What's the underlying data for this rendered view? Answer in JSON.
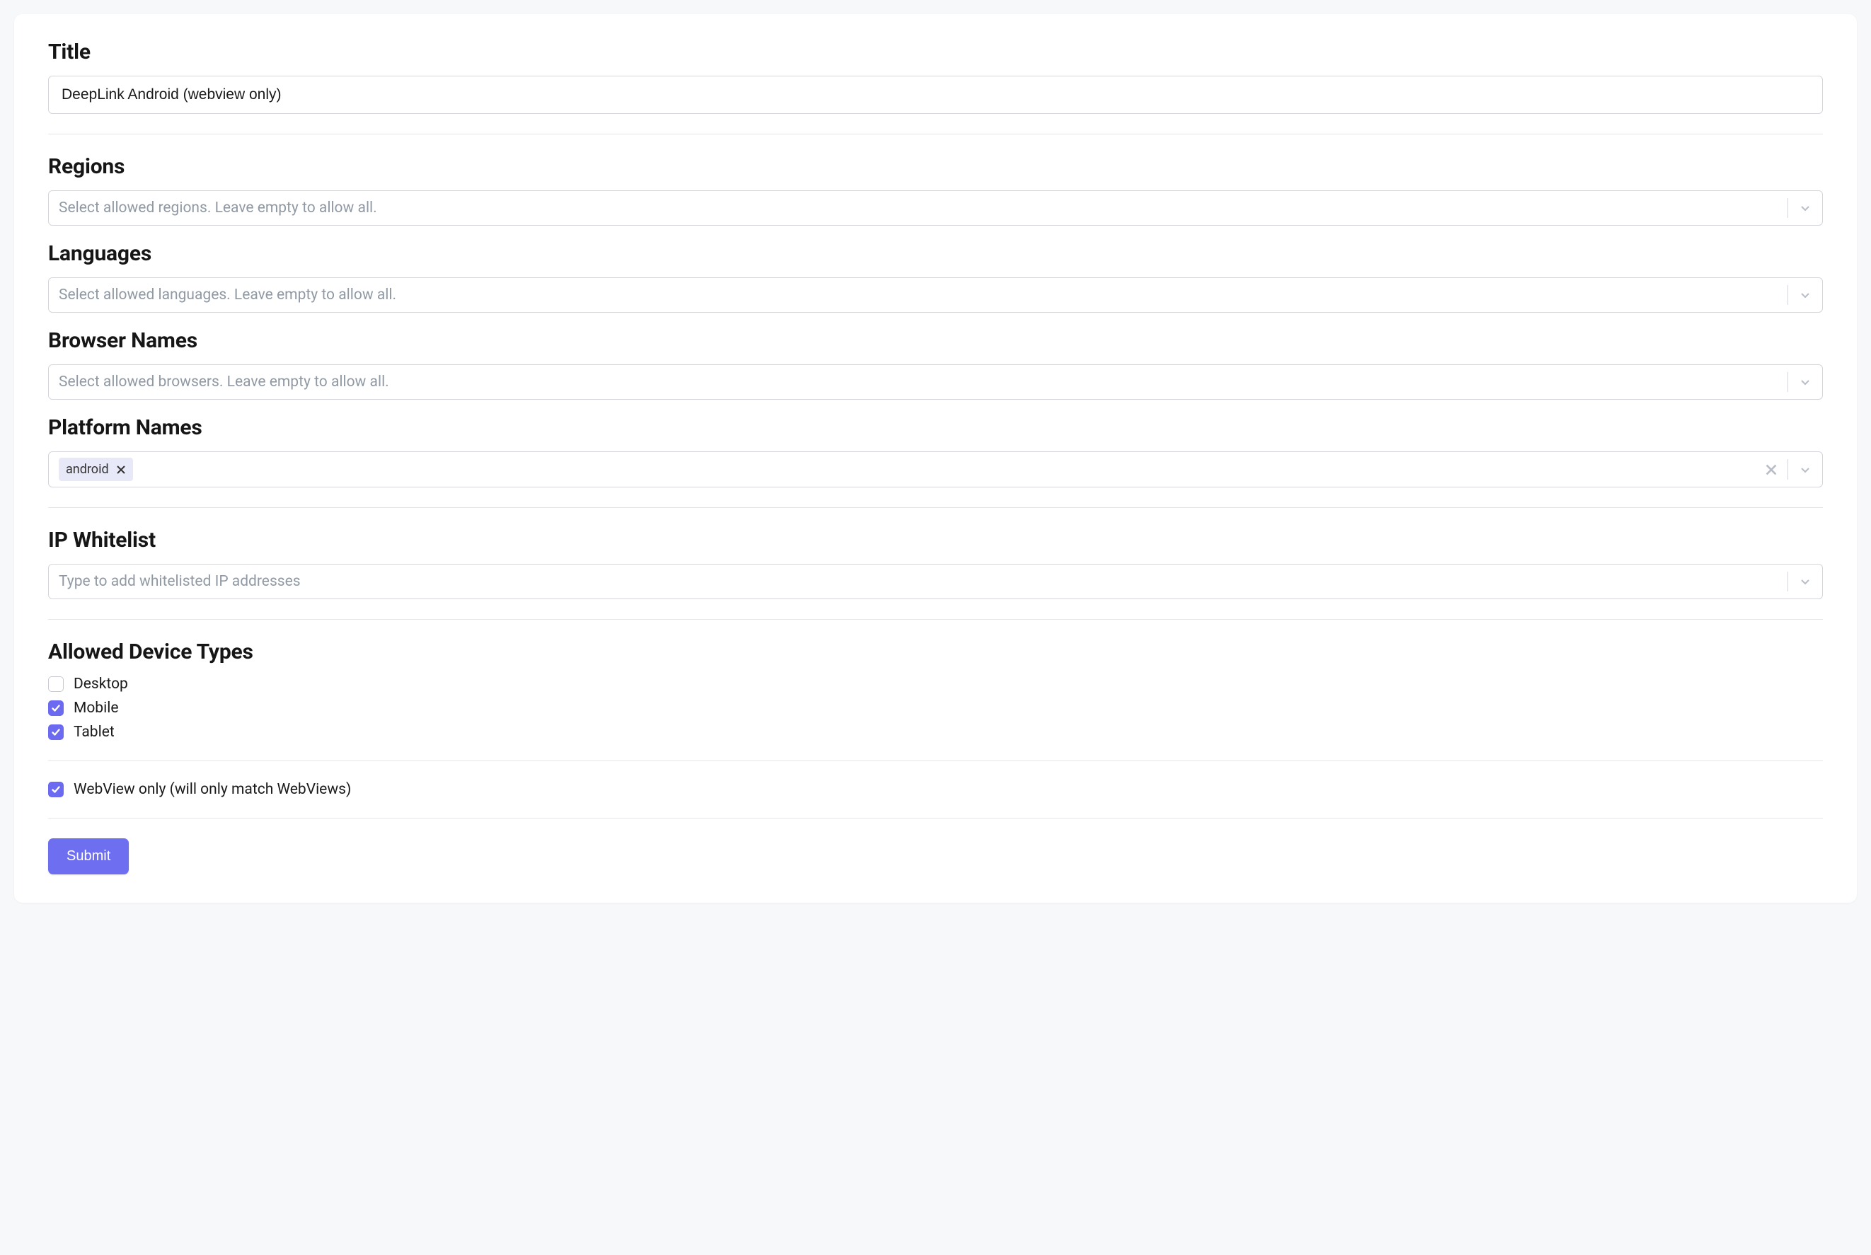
{
  "title": {
    "label": "Title",
    "value": "DeepLink Android (webview only)"
  },
  "regions": {
    "label": "Regions",
    "placeholder": "Select allowed regions. Leave empty to allow all.",
    "selected": []
  },
  "languages": {
    "label": "Languages",
    "placeholder": "Select allowed languages. Leave empty to allow all.",
    "selected": []
  },
  "browsers": {
    "label": "Browser Names",
    "placeholder": "Select allowed browsers. Leave empty to allow all.",
    "selected": []
  },
  "platforms": {
    "label": "Platform Names",
    "selected": [
      "android"
    ]
  },
  "ip_whitelist": {
    "label": "IP Whitelist",
    "placeholder": "Type to add whitelisted IP addresses",
    "values": []
  },
  "device_types": {
    "label": "Allowed Device Types",
    "options": [
      {
        "label": "Desktop",
        "checked": false
      },
      {
        "label": "Mobile",
        "checked": true
      },
      {
        "label": "Tablet",
        "checked": true
      }
    ]
  },
  "webview_only": {
    "label": "WebView only (will only match WebViews)",
    "checked": true
  },
  "submit_label": "Submit"
}
